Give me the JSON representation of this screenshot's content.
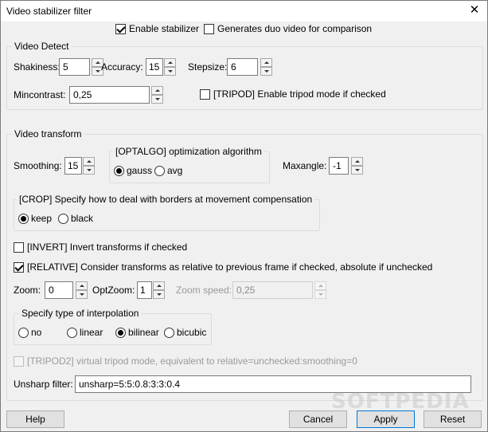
{
  "window": {
    "title": "Video stabilizer filter",
    "close_glyph": "✕"
  },
  "top_options": {
    "enable_stabilizer": {
      "label": "Enable stabilizer",
      "checked": true
    },
    "duo_video": {
      "label": "Generates duo video for comparison",
      "checked": false
    }
  },
  "video_detect": {
    "title": "Video Detect",
    "shakiness": {
      "label": "Shakiness:",
      "value": "5"
    },
    "accuracy": {
      "label": "Accuracy:",
      "value": "15"
    },
    "stepsize": {
      "label": "Stepsize:",
      "value": "6"
    },
    "mincontrast": {
      "label": "Mincontrast:",
      "value": "0,25"
    },
    "tripod": {
      "label": "[TRIPOD] Enable tripod mode if checked",
      "checked": false
    }
  },
  "video_transform": {
    "title": "Video transform",
    "smoothing": {
      "label": "Smoothing:",
      "value": "15"
    },
    "optalgo": {
      "title": "[OPTALGO] optimization algorithm",
      "options": [
        {
          "label": "gauss",
          "selected": true
        },
        {
          "label": "avg",
          "selected": false
        }
      ]
    },
    "maxangle": {
      "label": "Maxangle:",
      "value": "-1"
    },
    "crop": {
      "title": "[CROP] Specify how to deal with borders at movement compensation",
      "options": [
        {
          "label": "keep",
          "selected": true
        },
        {
          "label": "black",
          "selected": false
        }
      ]
    },
    "invert": {
      "label": "[INVERT] Invert transforms if checked",
      "checked": false
    },
    "relative": {
      "label": "[RELATIVE] Consider transforms as relative to previous frame if checked, absolute if unchecked",
      "checked": true
    },
    "zoom": {
      "label": "Zoom:",
      "value": "0"
    },
    "optzoom": {
      "label": "OptZoom:",
      "value": "1"
    },
    "zoom_speed": {
      "label": "Zoom speed:",
      "value": "0,25",
      "disabled": true
    },
    "interpolation": {
      "title": "Specify type of interpolation",
      "options": [
        {
          "label": "no",
          "selected": false
        },
        {
          "label": "linear",
          "selected": false
        },
        {
          "label": "bilinear",
          "selected": true
        },
        {
          "label": "bicubic",
          "selected": false
        }
      ]
    },
    "tripod2": {
      "label": "[TRIPOD2] virtual tripod mode, equivalent to relative=unchecked:smoothing=0",
      "checked": false,
      "disabled": true
    },
    "unsharp": {
      "label": "Unsharp filter:",
      "value": "unsharp=5:5:0.8:3:3:0.4"
    }
  },
  "buttons": {
    "help": "Help",
    "cancel": "Cancel",
    "apply": "Apply",
    "reset": "Reset"
  },
  "watermark": "SOFTPEDIA"
}
